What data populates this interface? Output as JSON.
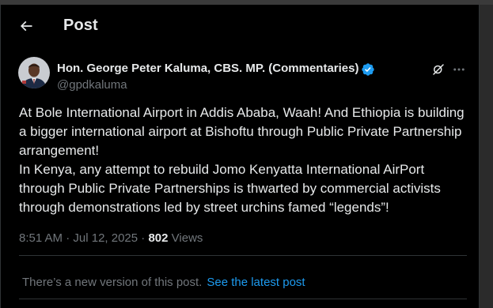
{
  "header": {
    "title": "Post",
    "back_icon": "arrow-left-icon"
  },
  "author": {
    "name": "Hon. George Peter Kaluma, CBS. MP. (Commentaries)",
    "handle": "@gpdkaluma",
    "verified_color": "#1d9bf0"
  },
  "post": {
    "text": "At Bole International Airport in Addis Ababa, Waah! And Ethiopia is building a bigger international airport at Bishoftu through Public Private Partnership arrangement!\nIn Kenya, any attempt to rebuild Jomo Kenyatta International AirPort through Public Private Partnerships is thwarted by commercial activists through demonstrations led by street urchins famed “legends”!",
    "time": "8:51 AM",
    "separator1": "·",
    "date": "Jul 12, 2025",
    "separator2": "·",
    "views_count": "802",
    "views_label": "Views"
  },
  "notice": {
    "text": "There’s a new version of this post.",
    "link": "See the latest post"
  },
  "colors": {
    "background": "#000000",
    "text": "#e7e9ea",
    "muted": "#71767b",
    "accent": "#1d9bf0",
    "border": "#2f3336"
  }
}
